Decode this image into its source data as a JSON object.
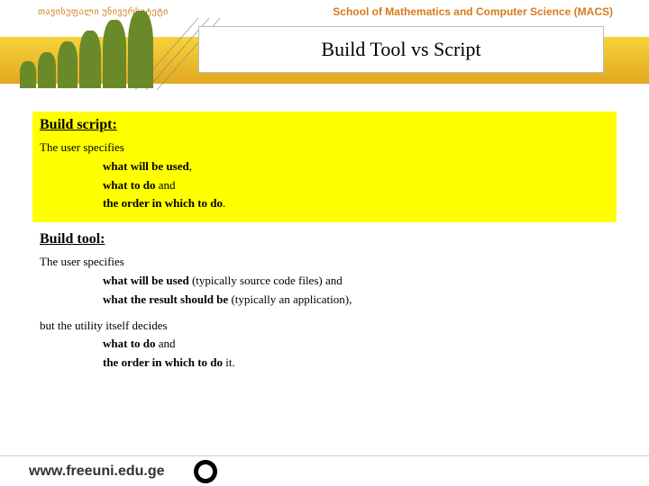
{
  "top": {
    "university": "თავისუფალი უნივერსიტეტი",
    "school": "School of Mathematics and Computer Science (MACS)"
  },
  "title": "Build Tool vs Script",
  "script_block": {
    "heading": "Build script:",
    "lead": "The user specifies",
    "l1_b": "what will be used",
    "l1_r": ",",
    "l2_b": "what to do",
    "l2_r": " and",
    "l3_b": "the order in which to do",
    "l3_r": "."
  },
  "tool_block": {
    "heading": "Build tool:",
    "lead1": "The user specifies",
    "a1_b": "what will be used",
    "a1_r": " (typically source code files) and",
    "a2_b": "what the result should be",
    "a2_r": " (typically an application),",
    "lead2": "but the utility itself decides",
    "b1_b": "what to do",
    "b1_r": " and",
    "b2_b": "the order in which to do",
    "b2_r": " it."
  },
  "footer": {
    "url": "www.freeuni.edu.ge"
  }
}
